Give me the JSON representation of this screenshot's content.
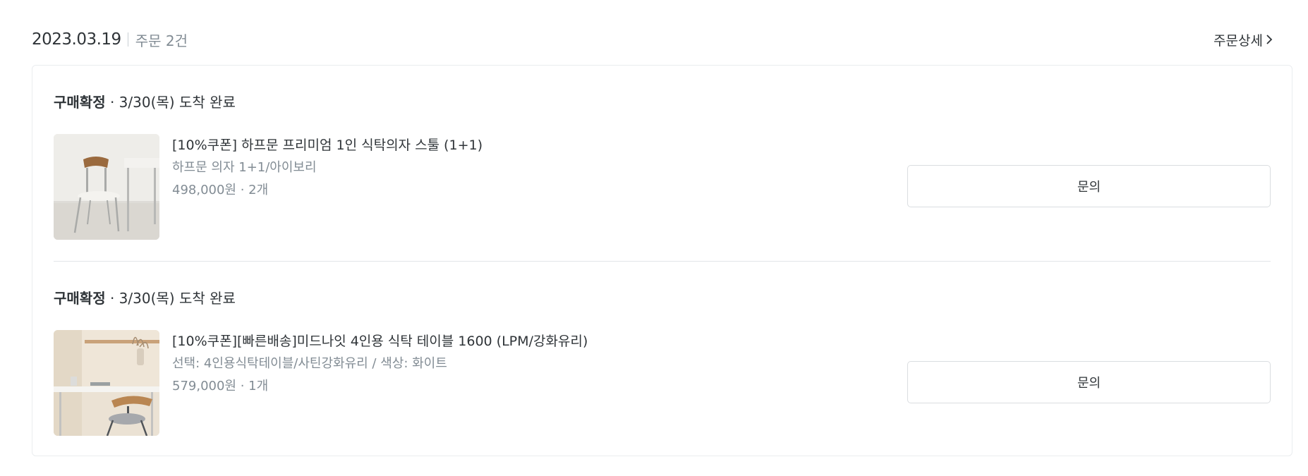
{
  "order": {
    "date": "2023.03.19",
    "count_label": "주문 2건",
    "detail_link_label": "주문상세"
  },
  "items": [
    {
      "status": "구매확정",
      "status_detail": " · 3/30(목) 도착 완료",
      "name": "[10%쿠폰] 하프문 프리미엄 1인 식탁의자 스툴 (1+1)",
      "option": "하프문 의자 1+1/아이보리",
      "price_qty": "498,000원 · 2개",
      "inquiry_label": "문의",
      "thumbnail": "chair-product-photo"
    },
    {
      "status": "구매확정",
      "status_detail": " · 3/30(목) 도착 완료",
      "name": "[10%쿠폰][빠른배송]미드나잇 4인용 식탁 테이블 1600 (LPM/강화유리)",
      "option": "선택: 4인용식탁테이블/사틴강화유리 / 색상: 화이트",
      "price_qty": "579,000원 · 1개",
      "inquiry_label": "문의",
      "thumbnail": "table-product-photo"
    }
  ],
  "colors": {
    "primary_text": "#2f3438",
    "secondary_text": "#828c94",
    "border": "#dadde0",
    "card_border": "#eaedef"
  }
}
